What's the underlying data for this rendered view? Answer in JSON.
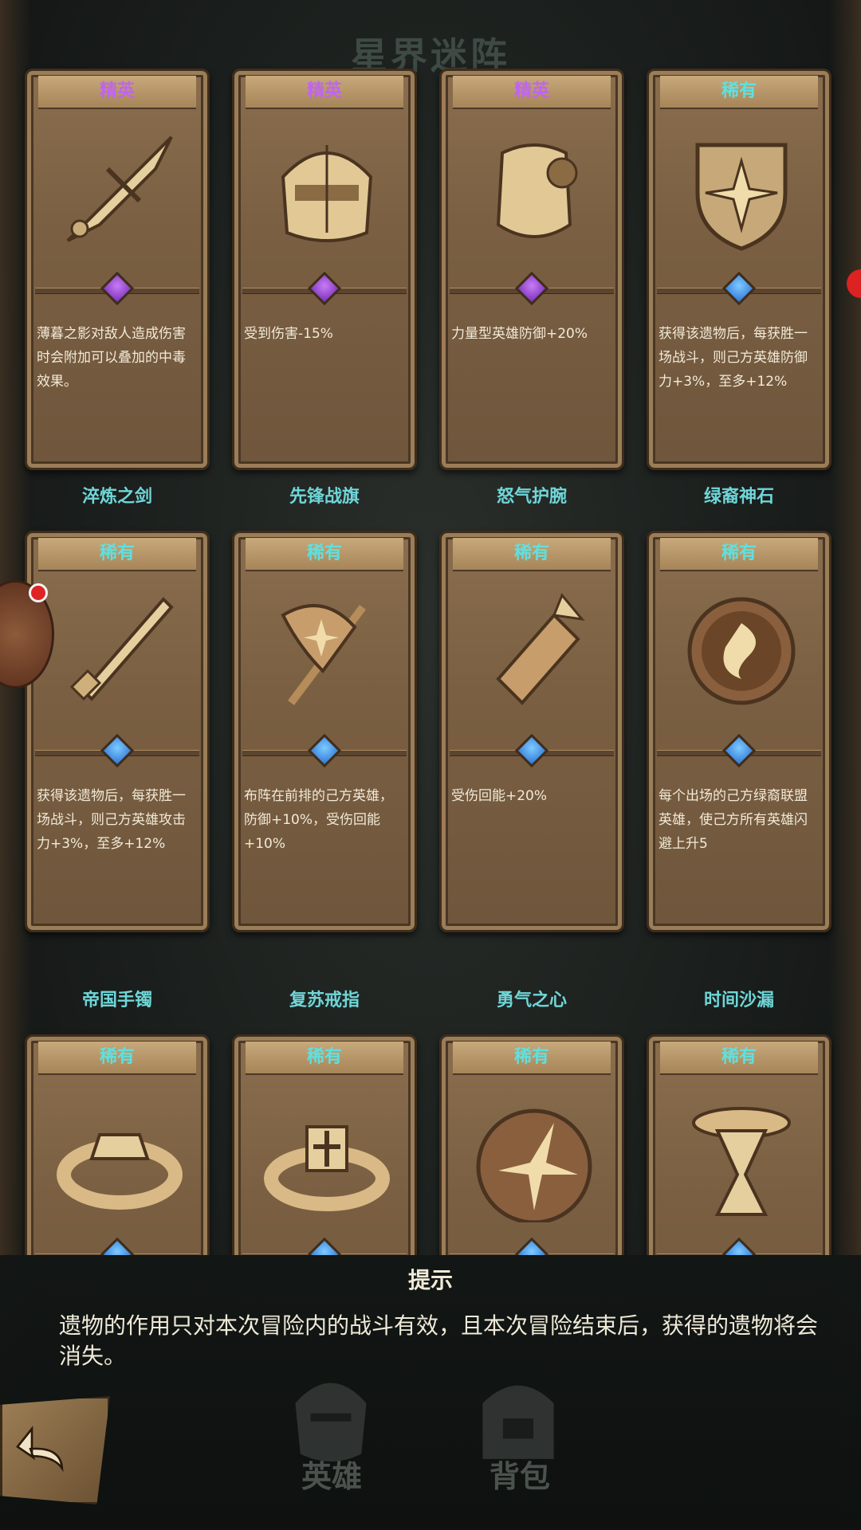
{
  "bg_title": "星界迷阵",
  "cards": [
    [
      {
        "name": "",
        "rarity": "精英",
        "rarity_type": "elite",
        "icon": "shadow-dagger-icon",
        "desc": "薄暮之影对敌人造成伤害时会附加可以叠加的中毒效果。"
      },
      {
        "name": "",
        "rarity": "精英",
        "rarity_type": "elite",
        "icon": "knight-helmet-icon",
        "desc": "受到伤害-15%"
      },
      {
        "name": "",
        "rarity": "精英",
        "rarity_type": "elite",
        "icon": "breastplate-icon",
        "desc": "力量型英雄防御+20%"
      },
      {
        "name": "",
        "rarity": "稀有",
        "rarity_type": "rare",
        "icon": "star-shield-icon",
        "desc": "获得该遗物后，每获胜一场战斗，则己方英雄防御力+3%，至多+12%"
      }
    ],
    [
      {
        "name": "淬炼之剑",
        "rarity": "稀有",
        "rarity_type": "rare",
        "icon": "sword-icon",
        "desc": "获得该遗物后，每获胜一场战斗，则己方英雄攻击力+3%，至多+12%"
      },
      {
        "name": "先锋战旗",
        "rarity": "稀有",
        "rarity_type": "rare",
        "icon": "war-banner-icon",
        "desc": "布阵在前排的己方英雄，防御+10%，受伤回能+10%"
      },
      {
        "name": "怒气护腕",
        "rarity": "稀有",
        "rarity_type": "rare",
        "icon": "bracer-icon",
        "desc": "受伤回能+20%"
      },
      {
        "name": "绿裔神石",
        "rarity": "稀有",
        "rarity_type": "rare",
        "icon": "spiral-stone-icon",
        "desc": "每个出场的己方绿裔联盟英雄，使己方所有英雄闪避上升5"
      }
    ],
    [
      {
        "name": "帝国手镯",
        "rarity": "稀有",
        "rarity_type": "rare",
        "icon": "bracelet-icon",
        "desc": ""
      },
      {
        "name": "复苏戒指",
        "rarity": "稀有",
        "rarity_type": "rare",
        "icon": "cross-ring-icon",
        "desc": ""
      },
      {
        "name": "勇气之心",
        "rarity": "稀有",
        "rarity_type": "rare",
        "icon": "star-orb-icon",
        "desc": ""
      },
      {
        "name": "时间沙漏",
        "rarity": "稀有",
        "rarity_type": "rare",
        "icon": "hourglass-icon",
        "desc": ""
      }
    ]
  ],
  "hint": {
    "title": "提示",
    "text": "遗物的作用只对本次冒险内的战斗有效，且本次冒险结束后，获得的遗物将会消失。"
  },
  "nav": {
    "hero": "英雄",
    "bag": "背包"
  },
  "colors": {
    "elite": "#c064f0",
    "rare": "#5fe0e0",
    "name": "#6fd6d8",
    "card": "#7a5f42"
  }
}
